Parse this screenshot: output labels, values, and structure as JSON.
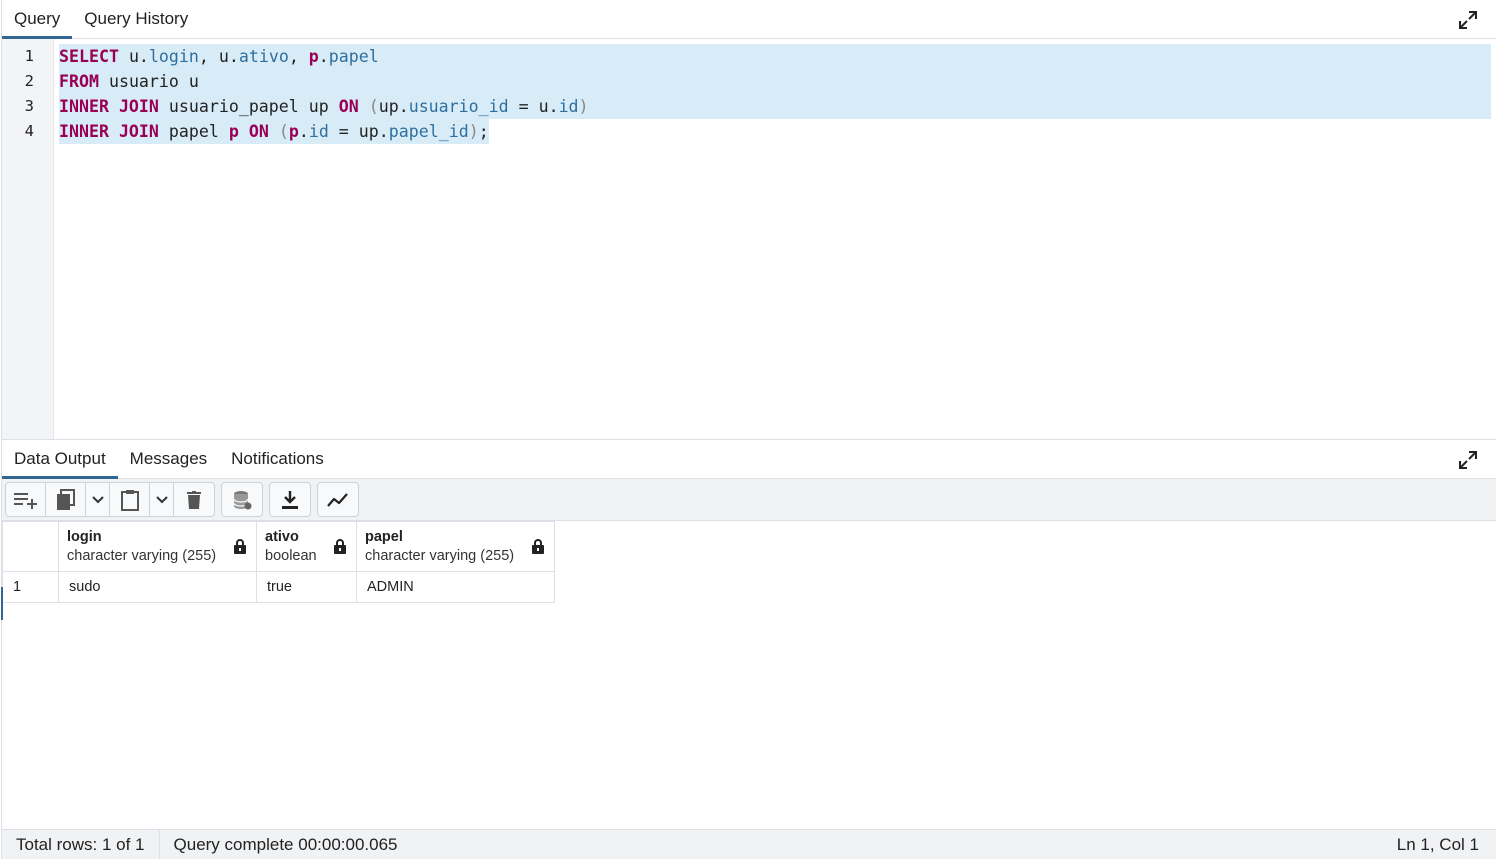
{
  "query_panel": {
    "tabs": [
      {
        "label": "Query",
        "active": true
      },
      {
        "label": "Query History",
        "active": false
      }
    ],
    "line_numbers": [
      "1",
      "2",
      "3",
      "4"
    ],
    "code": {
      "l1": {
        "kw1": "SELECT",
        "t1": " u.",
        "c1": "login",
        "t2": ", u.",
        "c2": "ativo",
        "t3": ", ",
        "kw2": "p",
        "t4": ".",
        "c3": "papel"
      },
      "l2": {
        "kw1": "FROM",
        "t1": " usuario u"
      },
      "l3": {
        "kw1": "INNER JOIN",
        "t1": " usuario_papel up ",
        "kw2": "ON",
        "t2": " ",
        "p1": "(",
        "t3": "up.",
        "c1": "usuario_id",
        "t4": " = u.",
        "c2": "id",
        "p2": ")"
      },
      "l4": {
        "kw1": "INNER JOIN",
        "t1": " papel ",
        "kw2": "p",
        "t2": " ",
        "kw3": "ON",
        "t3": " ",
        "p1": "(",
        "kw4": "p",
        "t4": ".",
        "c1": "id",
        "t5": " = up.",
        "c2": "papel_id",
        "p2": ")",
        "t6": ";"
      }
    },
    "expand_icon": "expand-icon"
  },
  "output_panel": {
    "tabs": [
      {
        "label": "Data Output",
        "active": true
      },
      {
        "label": "Messages",
        "active": false
      },
      {
        "label": "Notifications",
        "active": false
      }
    ],
    "toolbar_icons": [
      "add-row-icon",
      "copy-icon",
      "chevron-down-icon",
      "paste-icon",
      "chevron-down-icon",
      "delete-icon",
      "save-data-icon",
      "download-icon",
      "graph-icon"
    ],
    "columns": [
      {
        "name": "login",
        "type": "character varying (255)"
      },
      {
        "name": "ativo",
        "type": "boolean"
      },
      {
        "name": "papel",
        "type": "character varying (255)"
      }
    ],
    "rows": [
      {
        "num": "1",
        "login": "sudo",
        "ativo": "true",
        "papel": "ADMIN"
      }
    ]
  },
  "status": {
    "total_rows": "Total rows: 1 of 1",
    "query_complete": "Query complete 00:00:00.065",
    "cursor": "Ln 1, Col 1"
  },
  "colors": {
    "accent": "#326690",
    "keyword": "#990055",
    "identifier": "#2f6f9f",
    "selection": "#d8ecf8"
  }
}
